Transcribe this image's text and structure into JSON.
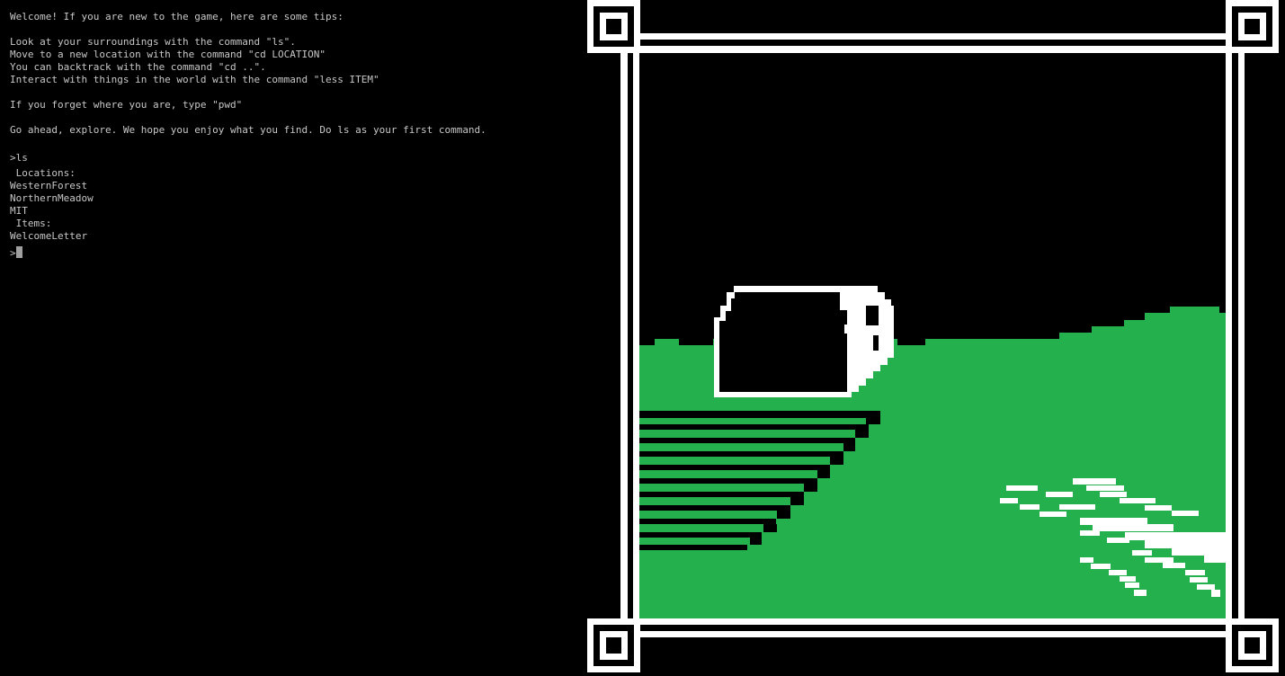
{
  "terminal": {
    "intro": [
      "Welcome! If you are new to the game, here are some tips:",
      "Look at your surroundings with the command \"ls\".",
      "Move to a new location with the command \"cd LOCATION\"",
      "You can backtrack with the command \"cd ..\".",
      "Interact with things in the world with the command \"less ITEM\"",
      "If you forget where you are, type \"pwd\"",
      "Go ahead, explore. We hope you enjoy what you find. Do ls as your first command."
    ],
    "command": ">ls",
    "locations_header": " Locations:",
    "locations": [
      "WesternForest",
      "NorthernMeadow",
      "MIT"
    ],
    "items_header": " Items:",
    "items": [
      "WelcomeLetter"
    ],
    "prompt": ">"
  },
  "scene": {
    "frame_color": "#ffffff",
    "background_color": "#000000",
    "grass_color": "#24b04c",
    "rock_color": "#ffffff"
  }
}
